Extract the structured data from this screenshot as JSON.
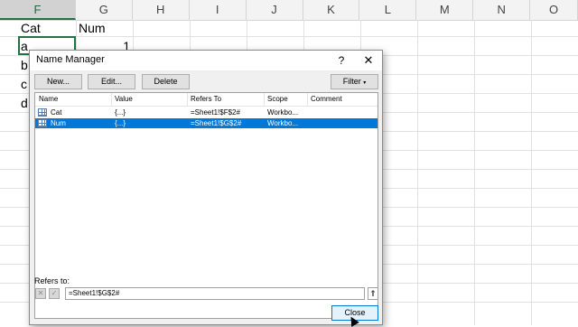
{
  "sheet": {
    "columns": [
      "F",
      "G",
      "H",
      "I",
      "J",
      "K",
      "L",
      "M",
      "N",
      "O"
    ],
    "active_column": "F",
    "cells": {
      "f1": "Cat",
      "g1": "Num",
      "f2": "a",
      "g2": "1",
      "f3": "b",
      "f4": "c",
      "f5": "d"
    }
  },
  "dialog": {
    "title": "Name Manager",
    "help_glyph": "?",
    "close_glyph": "✕",
    "buttons": {
      "new": "New...",
      "edit": "Edit...",
      "delete": "Delete",
      "filter": "Filter"
    },
    "columns": [
      "Name",
      "Value",
      "Refers To",
      "Scope",
      "Comment"
    ],
    "rows": [
      {
        "name": "Cat",
        "value": "{...}",
        "refers": "=Sheet1!$F$2#",
        "scope": "Workbo...",
        "comment": ""
      },
      {
        "name": "Num",
        "value": "{...}",
        "refers": "=Sheet1!$G$2#",
        "scope": "Workbo...",
        "comment": "",
        "selected": true
      }
    ],
    "refers_label": "Refers to:",
    "refers_value": "=Sheet1!$G$2#",
    "close_label": "Close"
  },
  "colors": {
    "accent": "#0078d7",
    "excel_green": "#217346"
  }
}
